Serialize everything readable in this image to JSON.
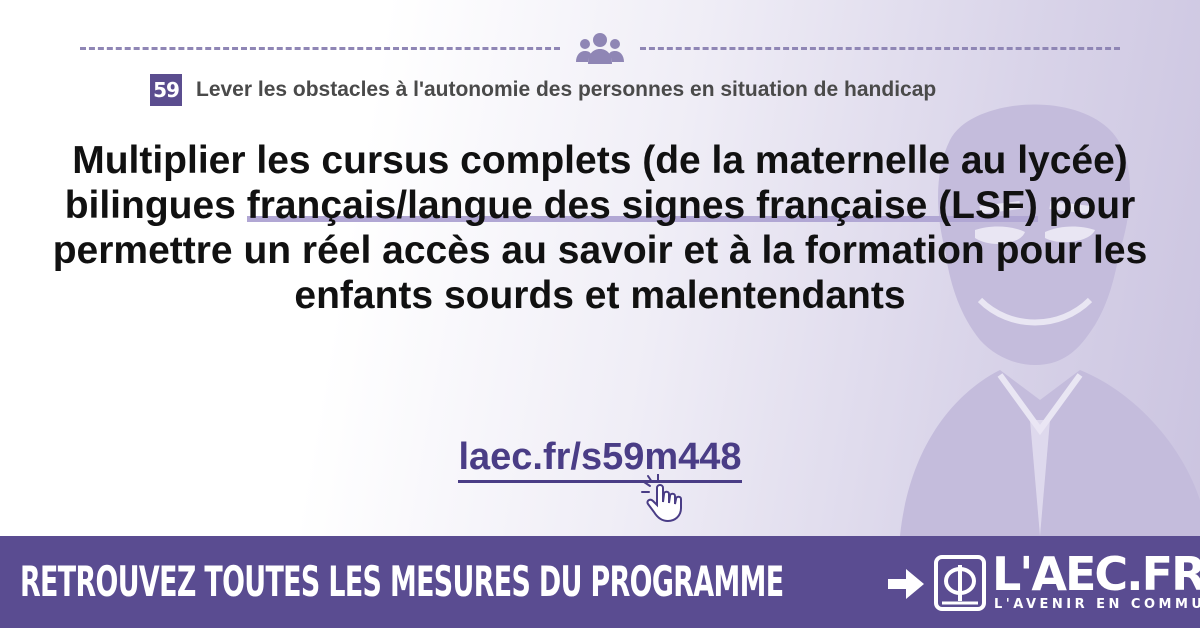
{
  "header": {
    "icon": "people-group-icon",
    "category_number": "59",
    "category_title": "Lever les obstacles à l'autonomie des personnes en situation de handicap"
  },
  "headline": {
    "part1": "Multiplier les cursus complets (de la maternelle au lycée) bilingues ",
    "highlight": "français/langue des signes française (LSF)",
    "part2": " pour permettre un réel accès au savoir et à la formation pour les enfants sourds et malentendants"
  },
  "shortlink": {
    "text": "laec.fr/s59m448",
    "icon": "pointer-hand-icon"
  },
  "banner": {
    "text": "RETROUVEZ TOUTES LES MESURES DU PROGRAMME",
    "arrow_icon": "arrow-right-icon",
    "logo_text": "L'AEC.FR",
    "logo_sub": "L'AVENIR EN COMMUN"
  },
  "colors": {
    "accent": "#5a4c91",
    "highlight": "#b1a7d4",
    "link": "#4a3d86"
  }
}
